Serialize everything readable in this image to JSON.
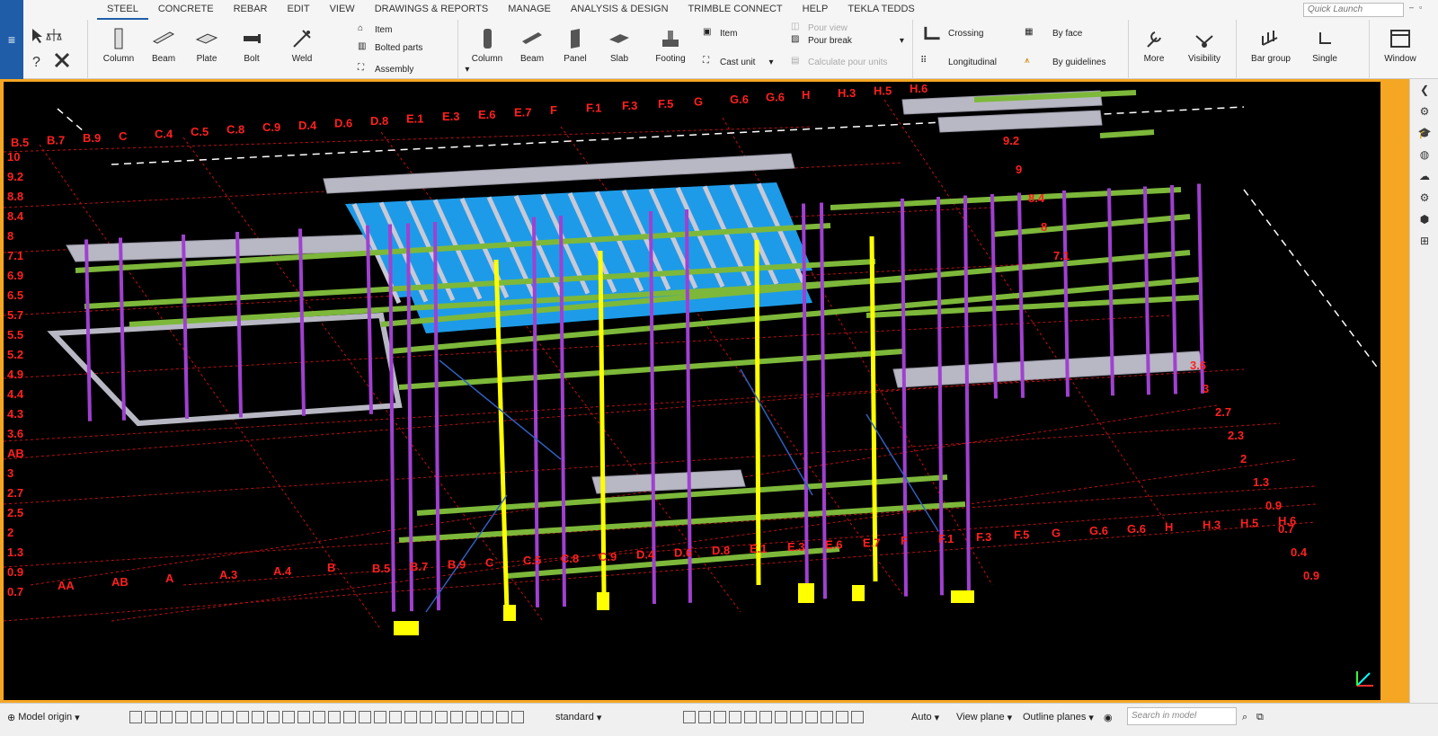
{
  "ribbon_tabs": [
    "STEEL",
    "CONCRETE",
    "REBAR",
    "EDIT",
    "VIEW",
    "DRAWINGS & REPORTS",
    "MANAGE",
    "ANALYSIS & DESIGN",
    "TRIMBLE CONNECT",
    "HELP",
    "TEKLA TEDDS"
  ],
  "active_tab": "STEEL",
  "quick_launch": {
    "placeholder": "Quick Launch"
  },
  "steel_group": {
    "column": "Column",
    "beam": "Beam",
    "plate": "Plate",
    "bolt": "Bolt",
    "weld": "Weld",
    "item": "Item",
    "bolted_parts": "Bolted parts",
    "assembly": "Assembly"
  },
  "concrete_group": {
    "column": "Column",
    "beam": "Beam",
    "panel": "Panel",
    "slab": "Slab",
    "footing": "Footing",
    "item": "Item",
    "cast_unit": "Cast unit",
    "pour_view": "Pour view",
    "pour_break": "Pour break",
    "calculate_pour_units": "Calculate pour units"
  },
  "rebar_group": {
    "crossing": "Crossing",
    "longitudinal": "Longitudinal",
    "by_face": "By face",
    "by_guidelines": "By guidelines"
  },
  "misc_group": {
    "more": "More",
    "visibility": "Visibility",
    "bar_group": "Bar group",
    "single": "Single",
    "window": "Window"
  },
  "grid_labels_top": [
    "B.5",
    "B.7",
    "B.9",
    "C",
    "C.4",
    "C.5",
    "C.8",
    "C.9",
    "D.4",
    "D.6",
    "D.8",
    "E.1",
    "E.3",
    "E.6",
    "E.7",
    "F",
    "F.1",
    "F.3",
    "F.5",
    "G",
    "G.6",
    "G.6",
    "H",
    "H.3",
    "H.5",
    "H.6"
  ],
  "grid_labels_left": [
    "10",
    "9.2",
    "8.8",
    "8.4",
    "8",
    "7.1",
    "6.9",
    "6.5",
    "5.7",
    "5.5",
    "5.2",
    "4.9",
    "4.4",
    "4.3",
    "3.6",
    "AB",
    "3",
    "2.7",
    "2.5",
    "2",
    "1.3",
    "0.9",
    "0.7",
    "AA",
    "AB",
    "A",
    "A.3",
    "A.4",
    "B"
  ],
  "grid_labels_bottom": [
    "B.5",
    "B.7",
    "B.9",
    "C",
    "C.5",
    "C.8",
    "C.9",
    "D.4",
    "D.6",
    "D.8",
    "E.1",
    "E.3",
    "E.6",
    "E.7",
    "F",
    "F.1",
    "F.3",
    "F.5",
    "G",
    "G.6",
    "G.6",
    "H",
    "H.3",
    "H.5",
    "H.6"
  ],
  "grid_labels_right": [
    "3.6",
    "3",
    "2.7",
    "2.3",
    "2",
    "1.3",
    "0.9",
    "0.7",
    "0.4",
    "0.9",
    "9.2",
    "9",
    "8.4",
    "8",
    "7.1"
  ],
  "status": {
    "model_origin": "Model origin",
    "standard": "standard",
    "auto": "Auto",
    "view_plane": "View plane",
    "outline_planes": "Outline planes",
    "search_placeholder": "Search in model"
  },
  "colors": {
    "accent": "#1f5da8",
    "viewport_border": "#f5a623",
    "grid": "#ff2020",
    "beam_green": "#7db83a",
    "column_purple": "#a040d0",
    "column_yellow": "#ffff00",
    "slab_blue": "#1e9be8",
    "steel_grey": "#b8b8c4"
  }
}
